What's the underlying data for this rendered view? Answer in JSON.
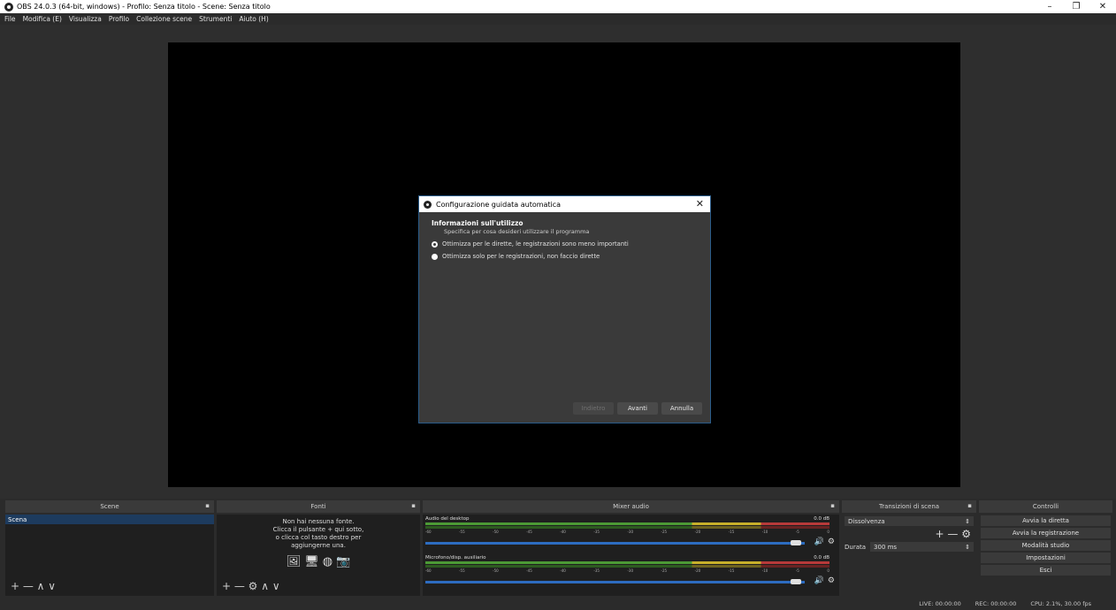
{
  "window": {
    "title": "OBS 24.0.3 (64-bit, windows) - Profilo: Senza titolo - Scene: Senza titolo",
    "minimize": "–",
    "maximize": "❐",
    "close": "✕"
  },
  "menu": [
    "File",
    "Modifica (E)",
    "Visualizza",
    "Profilo",
    "Collezione scene",
    "Strumenti",
    "Aiuto (H)"
  ],
  "dialog": {
    "title": "Configurazione guidata automatica",
    "close": "✕",
    "heading": "Informazioni sull'utilizzo",
    "subheading": "Specifica per cosa desideri utilizzare il programma",
    "option_stream": "Ottimizza per le dirette, le registrazioni sono meno importanti",
    "option_record": "Ottimizza solo per le registrazioni, non faccio dirette",
    "btn_back": "Indietro",
    "btn_next": "Avanti",
    "btn_cancel": "Annulla"
  },
  "docks": {
    "scenes": {
      "title": "Scene",
      "items": [
        "Scena"
      ],
      "tools": "+ — ∧ ∨"
    },
    "sources": {
      "title": "Fonti",
      "empty_1": "Non hai nessuna fonte.",
      "empty_2": "Clicca il pulsante + qui sotto,",
      "empty_3": "o clicca col tasto destro per",
      "empty_4": "aggiungerne una.",
      "tools": "+ — ⚙ ∧ ∨"
    },
    "mixer": {
      "title": "Mixer audio",
      "track1_name": "Audio del desktop",
      "track1_db": "0.0 dB",
      "track2_name": "Microfono/disp. ausiliario",
      "track2_db": "0.0 dB",
      "ticks": [
        "-60",
        "-55",
        "-50",
        "-45",
        "-40",
        "-35",
        "-30",
        "-25",
        "-20",
        "-15",
        "-10",
        "-5",
        "0"
      ]
    },
    "transitions": {
      "title": "Transizioni di scena",
      "selected": "Dissolvenza",
      "tools": "+ — ⚙",
      "duration_label": "Durata",
      "duration_value": "300 ms"
    },
    "controls": {
      "title": "Controlli",
      "start_stream": "Avvia la diretta",
      "start_record": "Avvia la registrazione",
      "studio_mode": "Modalità studio",
      "settings": "Impostazioni",
      "exit": "Esci"
    }
  },
  "status": {
    "live": "LIVE: 00:00:00",
    "rec": "REC: 00:00:00",
    "cpu": "CPU: 2.1%, 30.00 fps"
  }
}
